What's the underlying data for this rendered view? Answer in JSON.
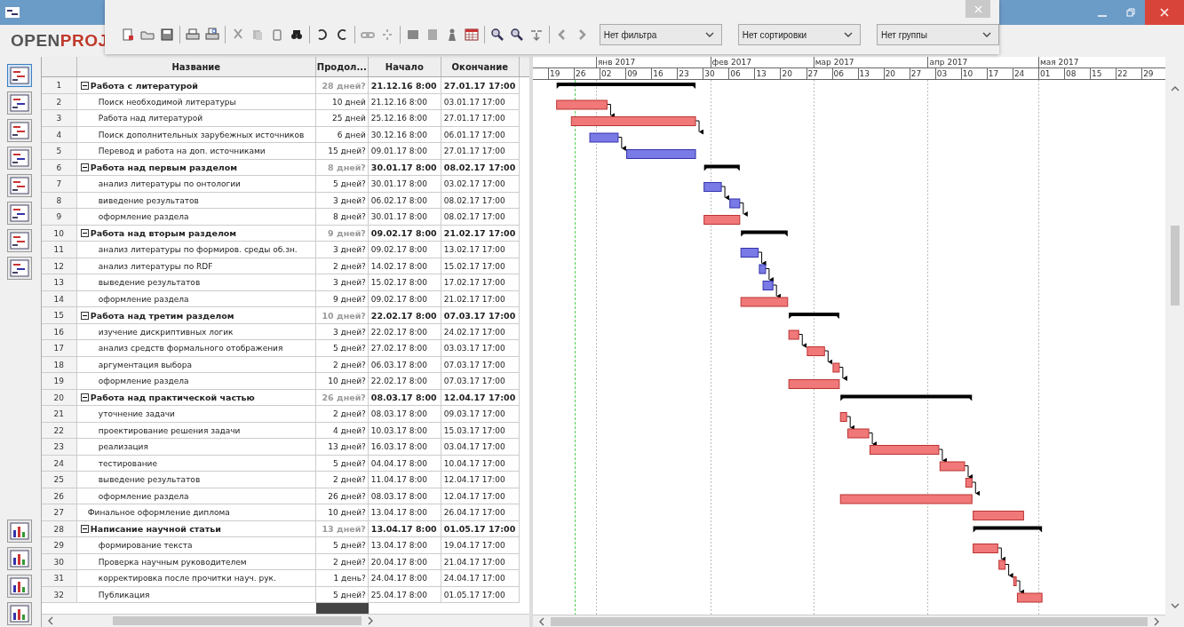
{
  "logo": {
    "first": "OPEN",
    "second": "PROJ"
  },
  "toolbar": {
    "filter": {
      "value": "Нет фильтра"
    },
    "sort": {
      "value": "Нет сортировки"
    },
    "group": {
      "value": "Нет группы"
    }
  },
  "table": {
    "columns": [
      "Название",
      "Продол...",
      "Начало",
      "Окончание"
    ],
    "rows": [
      {
        "number": "1",
        "name": "Работа с литературой",
        "duration": "28 дней?",
        "start": "21.12.16 8:00",
        "end": "27.01.17 17:00",
        "kind": "summary",
        "expanded": true,
        "children": [
          {
            "number": "2",
            "name": "Поиск необходимой литературы",
            "duration": "10 дней",
            "start": "21.12.16 8:00",
            "end": "03.01.17 17:00",
            "kind": "task",
            "critical": true
          },
          {
            "number": "3",
            "name": "Работа над литературой",
            "duration": "25 дней",
            "start": "25.12.16 8:00",
            "end": "27.01.17 17:00",
            "kind": "task",
            "critical": true
          },
          {
            "number": "4",
            "name": "Поиск дополнительных зарубежных источников",
            "duration": "6 дней",
            "start": "30.12.16 8:00",
            "end": "06.01.17 17:00",
            "kind": "task",
            "critical": false
          },
          {
            "number": "5",
            "name": "Перевод и работа на доп. источниками",
            "duration": "15 дней?",
            "start": "09.01.17 8:00",
            "end": "27.01.17 17:00",
            "kind": "task",
            "critical": false
          }
        ]
      },
      {
        "number": "6",
        "name": "Работа над первым разделом",
        "duration": "8 дней?",
        "start": "30.01.17 8:00",
        "end": "08.02.17 17:00",
        "kind": "summary",
        "expanded": true,
        "children": [
          {
            "number": "7",
            "name": "анализ литературы по онтологии",
            "duration": "5 дней?",
            "start": "30.01.17 8:00",
            "end": "03.02.17 17:00",
            "kind": "task",
            "critical": false
          },
          {
            "number": "8",
            "name": "виведение результатов",
            "duration": "3 дней?",
            "start": "06.02.17 8:00",
            "end": "08.02.17 17:00",
            "kind": "task",
            "critical": false
          },
          {
            "number": "9",
            "name": "оформление раздела",
            "duration": "8 дней?",
            "start": "30.01.17 8:00",
            "end": "08.02.17 17:00",
            "kind": "task",
            "critical": true
          }
        ]
      },
      {
        "number": "10",
        "name": "Работа над вторым разделом",
        "duration": "9 дней?",
        "start": "09.02.17 8:00",
        "end": "21.02.17 17:00",
        "kind": "summary",
        "expanded": true,
        "children": [
          {
            "number": "11",
            "name": "анализ литературы по формиров. среды об.зн.",
            "duration": "3 дней?",
            "start": "09.02.17 8:00",
            "end": "13.02.17 17:00",
            "kind": "task",
            "critical": false
          },
          {
            "number": "12",
            "name": "анализ литературы по RDF",
            "duration": "2 дней?",
            "start": "14.02.17 8:00",
            "end": "15.02.17 17:00",
            "kind": "task",
            "critical": false
          },
          {
            "number": "13",
            "name": "выведение результатов",
            "duration": "3 дней?",
            "start": "15.02.17 8:00",
            "end": "17.02.17 17:00",
            "kind": "task",
            "critical": false
          },
          {
            "number": "14",
            "name": "оформление раздела",
            "duration": "9 дней?",
            "start": "09.02.17 8:00",
            "end": "21.02.17 17:00",
            "kind": "task",
            "critical": true
          }
        ]
      },
      {
        "number": "15",
        "name": "Работа над третим разделом",
        "duration": "10 дней?",
        "start": "22.02.17 8:00",
        "end": "07.03.17 17:00",
        "kind": "summary",
        "expanded": true,
        "children": [
          {
            "number": "16",
            "name": "изучение дискриптивных логик",
            "duration": "3 дней?",
            "start": "22.02.17 8:00",
            "end": "24.02.17 17:00",
            "kind": "task",
            "critical": true
          },
          {
            "number": "17",
            "name": "анализ средств формального отображения",
            "duration": "5 дней?",
            "start": "27.02.17 8:00",
            "end": "03.03.17 17:00",
            "kind": "task",
            "critical": true
          },
          {
            "number": "18",
            "name": "аргументация выбора",
            "duration": "2 дней?",
            "start": "06.03.17 8:00",
            "end": "07.03.17 17:00",
            "kind": "task",
            "critical": true
          },
          {
            "number": "19",
            "name": "оформление раздела",
            "duration": "10 дней?",
            "start": "22.02.17 8:00",
            "end": "07.03.17 17:00",
            "kind": "task",
            "critical": true
          }
        ]
      },
      {
        "number": "20",
        "name": "Работа над практической частью",
        "duration": "26 дней?",
        "start": "08.03.17 8:00",
        "end": "12.04.17 17:00",
        "kind": "summary",
        "expanded": true,
        "children": [
          {
            "number": "21",
            "name": "уточнение задачи",
            "duration": "2 дней?",
            "start": "08.03.17 8:00",
            "end": "09.03.17 17:00",
            "kind": "task",
            "critical": true
          },
          {
            "number": "22",
            "name": "проектирование решения задачи",
            "duration": "4 дней?",
            "start": "10.03.17 8:00",
            "end": "15.03.17 17:00",
            "kind": "task",
            "critical": true
          },
          {
            "number": "23",
            "name": "реализация",
            "duration": "13 дней?",
            "start": "16.03.17 8:00",
            "end": "03.04.17 17:00",
            "kind": "task",
            "critical": true
          },
          {
            "number": "24",
            "name": "тестирование",
            "duration": "5 дней?",
            "start": "04.04.17 8:00",
            "end": "10.04.17 17:00",
            "kind": "task",
            "critical": true
          },
          {
            "number": "25",
            "name": "выведение результатов",
            "duration": "2 дней?",
            "start": "11.04.17 8:00",
            "end": "12.04.17 17:00",
            "kind": "task",
            "critical": true
          },
          {
            "number": "26",
            "name": "оформление раздела",
            "duration": "26 дней?",
            "start": "08.03.17 8:00",
            "end": "12.04.17 17:00",
            "kind": "task",
            "critical": true
          }
        ]
      },
      {
        "number": "27",
        "name": "Финальное оформление диплома",
        "duration": "10 дней?",
        "start": "13.04.17 8:00",
        "end": "26.04.17 17:00",
        "kind": "task",
        "critical": true
      },
      {
        "number": "28",
        "name": "Написание научной статьи",
        "duration": "13 дней?",
        "start": "13.04.17 8:00",
        "end": "01.05.17 17:00",
        "kind": "summary",
        "expanded": true,
        "children": [
          {
            "number": "29",
            "name": "формирование текста",
            "duration": "5 дней?",
            "start": "13.04.17 8:00",
            "end": "19.04.17 17:00",
            "kind": "task",
            "critical": true
          },
          {
            "number": "30",
            "name": "Проверка научным руководителем",
            "duration": "2 дней?",
            "start": "20.04.17 8:00",
            "end": "21.04.17 17:00",
            "kind": "task",
            "critical": true
          },
          {
            "number": "31",
            "name": "корректировка после прочитки науч. рук.",
            "duration": "1 день?",
            "start": "24.04.17 8:00",
            "end": "24.04.17 17:00",
            "kind": "task",
            "critical": true
          },
          {
            "number": "32",
            "name": "Публикация",
            "duration": "5 дней?",
            "start": "25.04.17 8:00",
            "end": "01.05.17 17:00",
            "kind": "task",
            "critical": true
          }
        ]
      }
    ]
  },
  "timeline": {
    "months": [
      "янв 2017",
      "фев 2017",
      "мар 2017",
      "апр 2017",
      "мая 2017"
    ],
    "weeks": [
      "19",
      "26",
      "02",
      "09",
      "16",
      "23",
      "30",
      "06",
      "13",
      "20",
      "27",
      "06",
      "13",
      "20",
      "27",
      "03",
      "10",
      "17",
      "24",
      "01",
      "08",
      "15",
      "22",
      "29"
    ]
  }
}
